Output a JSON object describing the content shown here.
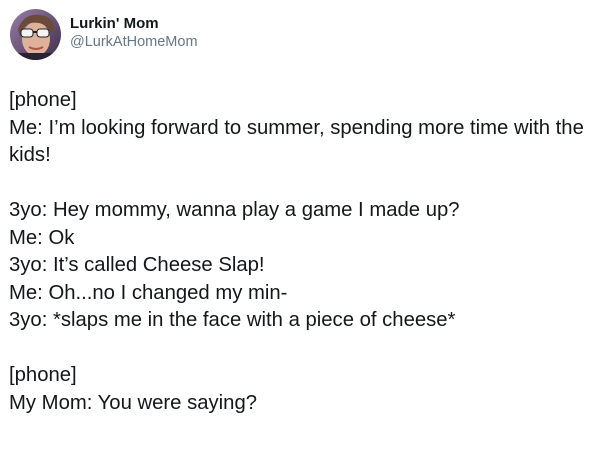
{
  "author": {
    "display_name": "Lurkin' Mom",
    "handle": "@LurkAtHomeMom"
  },
  "tweet": {
    "lines": [
      "[phone]",
      "Me: I’m looking forward to summer, spending more time with the kids!",
      "",
      "3yo: Hey mommy, wanna play a game I made up?",
      "Me: Ok",
      "3yo: It’s called Cheese Slap!",
      "Me: Oh...no I changed my min-",
      "3yo: *slaps me in the face with a piece of cheese*",
      "",
      "[phone]",
      "My Mom: You were saying?"
    ]
  },
  "colors": {
    "text": "#14171a",
    "secondary_text": "#657786",
    "background": "#ffffff"
  }
}
